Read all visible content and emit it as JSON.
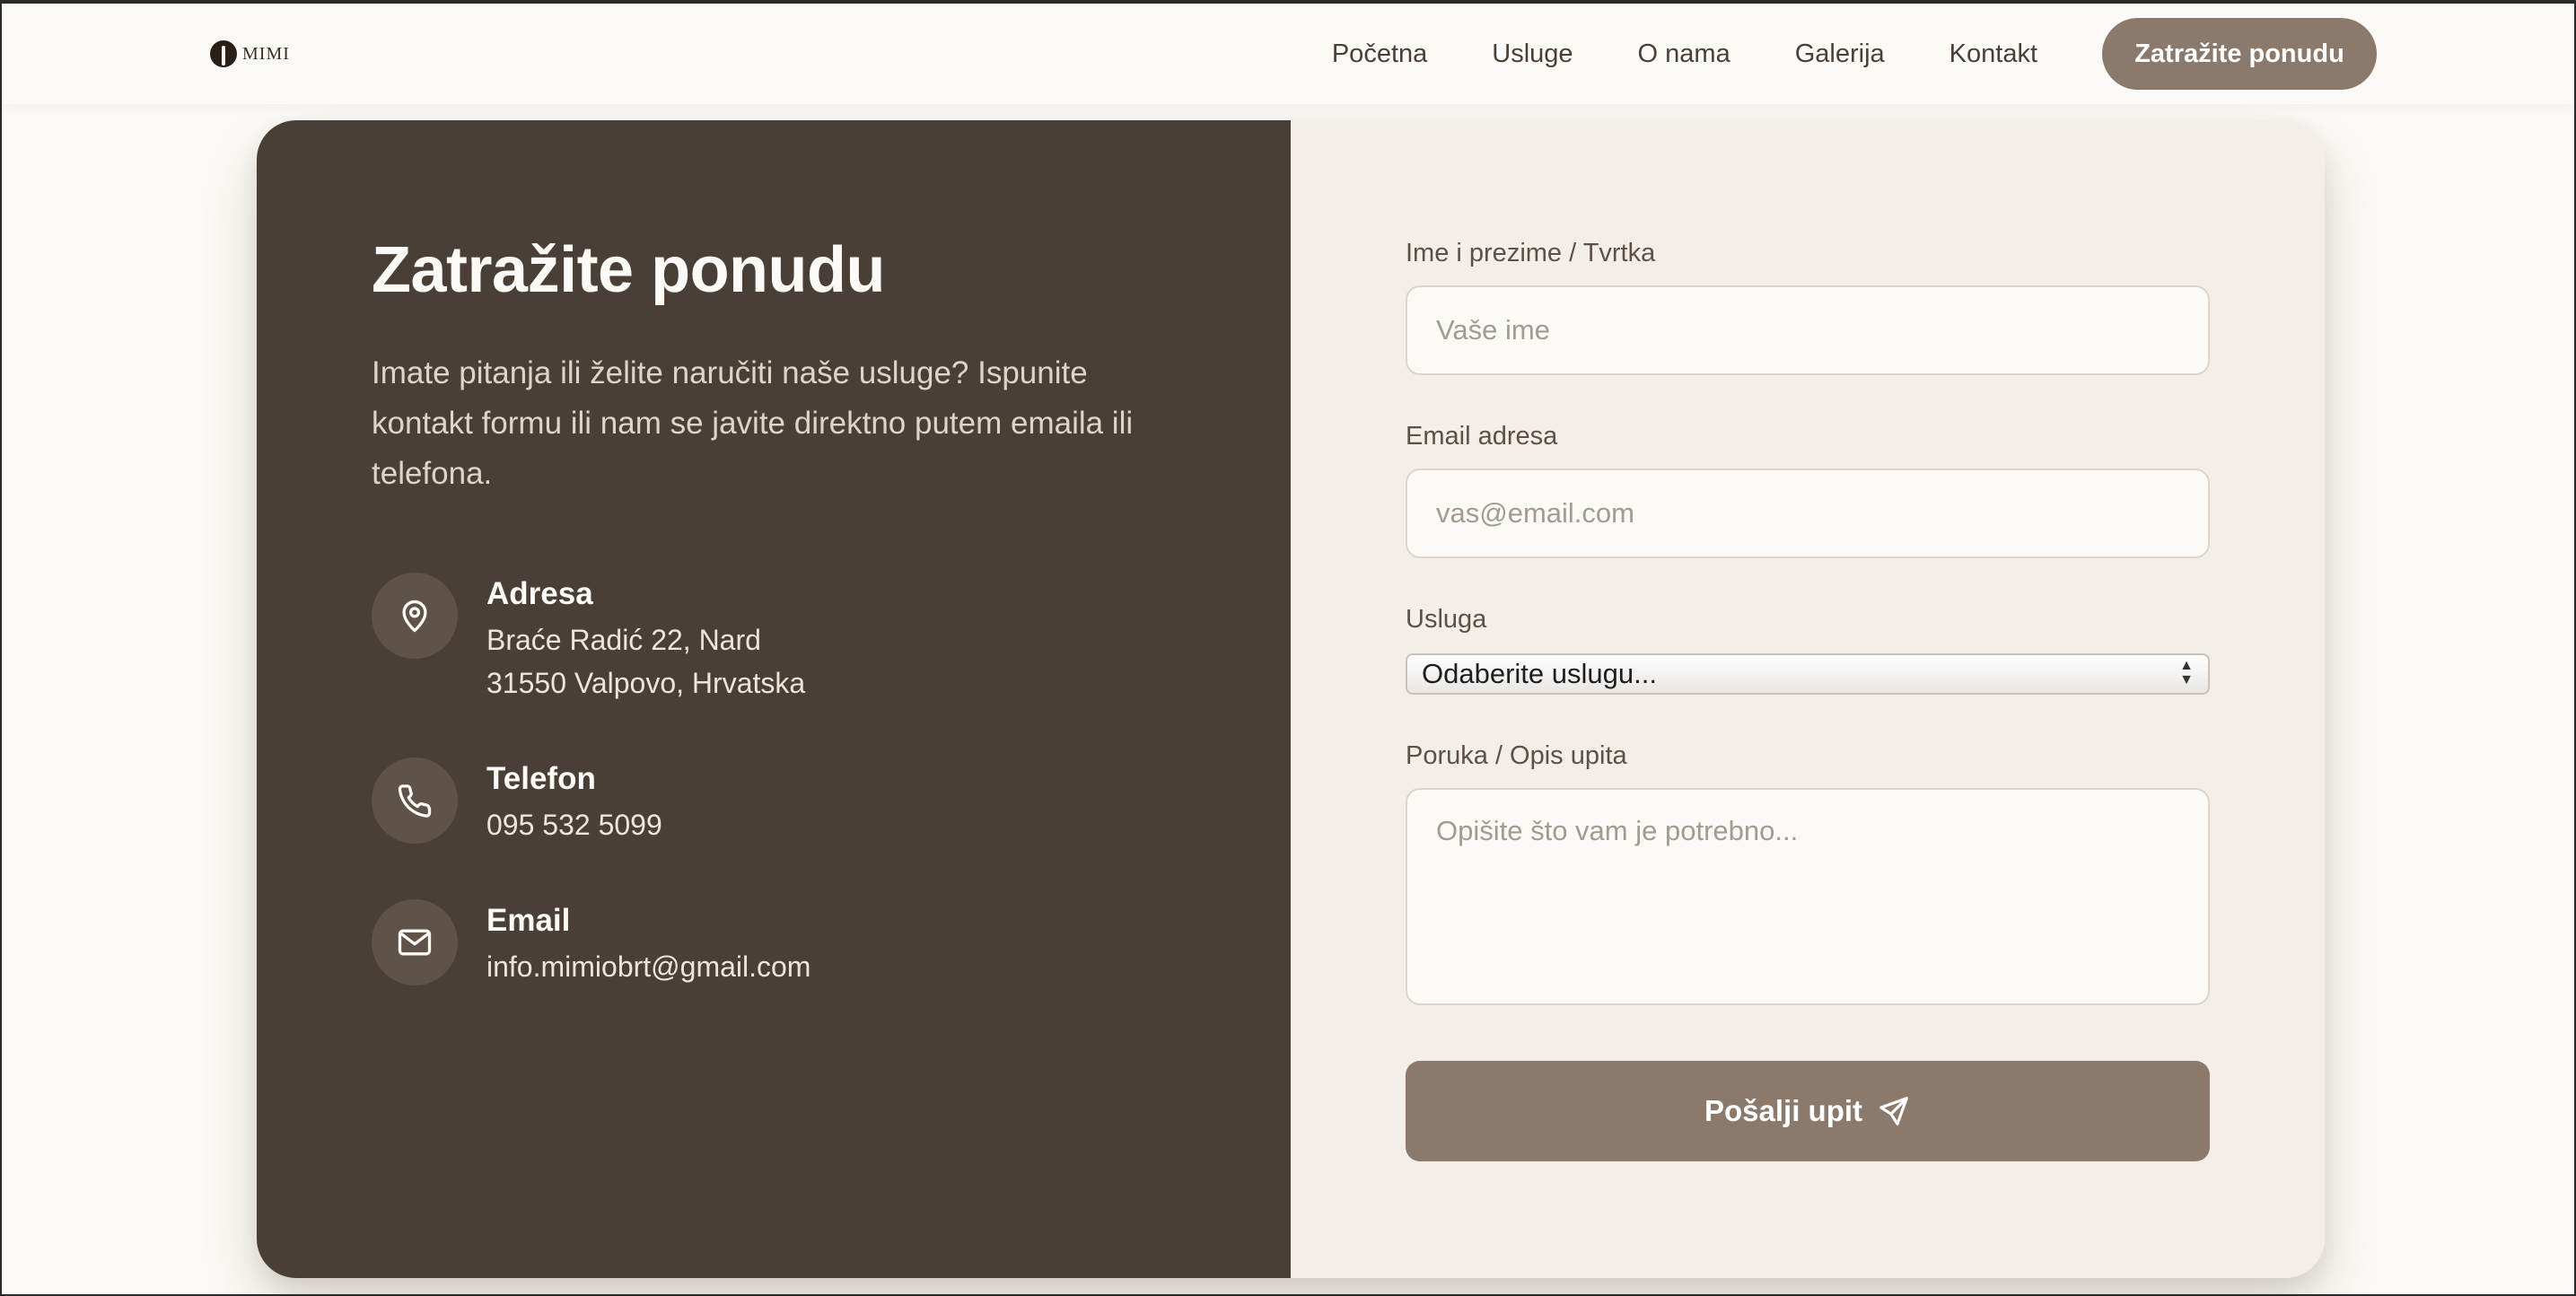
{
  "nav": {
    "logo_text": "MIMI",
    "links": [
      "Početna",
      "Usluge",
      "O nama",
      "Galerija",
      "Kontakt"
    ],
    "cta_label": "Zatražite ponudu"
  },
  "contact": {
    "heading": "Zatražite ponudu",
    "intro": "Imate pitanja ili želite naručiti naše usluge? Ispunite kontakt formu ili nam se javite direktno putem emaila ili telefona.",
    "address": {
      "title": "Adresa",
      "line1": "Braće Radić 22, Nard",
      "line2": "31550 Valpovo, Hrvatska",
      "icon": "map-pin-icon"
    },
    "phone": {
      "title": "Telefon",
      "value": "095 532 5099",
      "icon": "phone-icon"
    },
    "email": {
      "title": "Email",
      "value": "info.mimiobrt@gmail.com",
      "icon": "mail-icon"
    }
  },
  "form": {
    "name_label": "Ime i prezime / Tvrtka",
    "name_placeholder": "Vaše ime",
    "email_label": "Email adresa",
    "email_placeholder": "vas@email.com",
    "service_label": "Usluga",
    "service_selected": "Odaberite uslugu...",
    "message_label": "Poruka / Opis upita",
    "message_placeholder": "Opišite što vam je potrebno...",
    "submit_label": "Pošalji upit",
    "submit_icon": "send-icon"
  },
  "colors": {
    "page_bg": "#fbfaf6",
    "panel_dark": "#4a3f36",
    "panel_light": "#f3efe8",
    "accent": "#8b7a6b"
  }
}
